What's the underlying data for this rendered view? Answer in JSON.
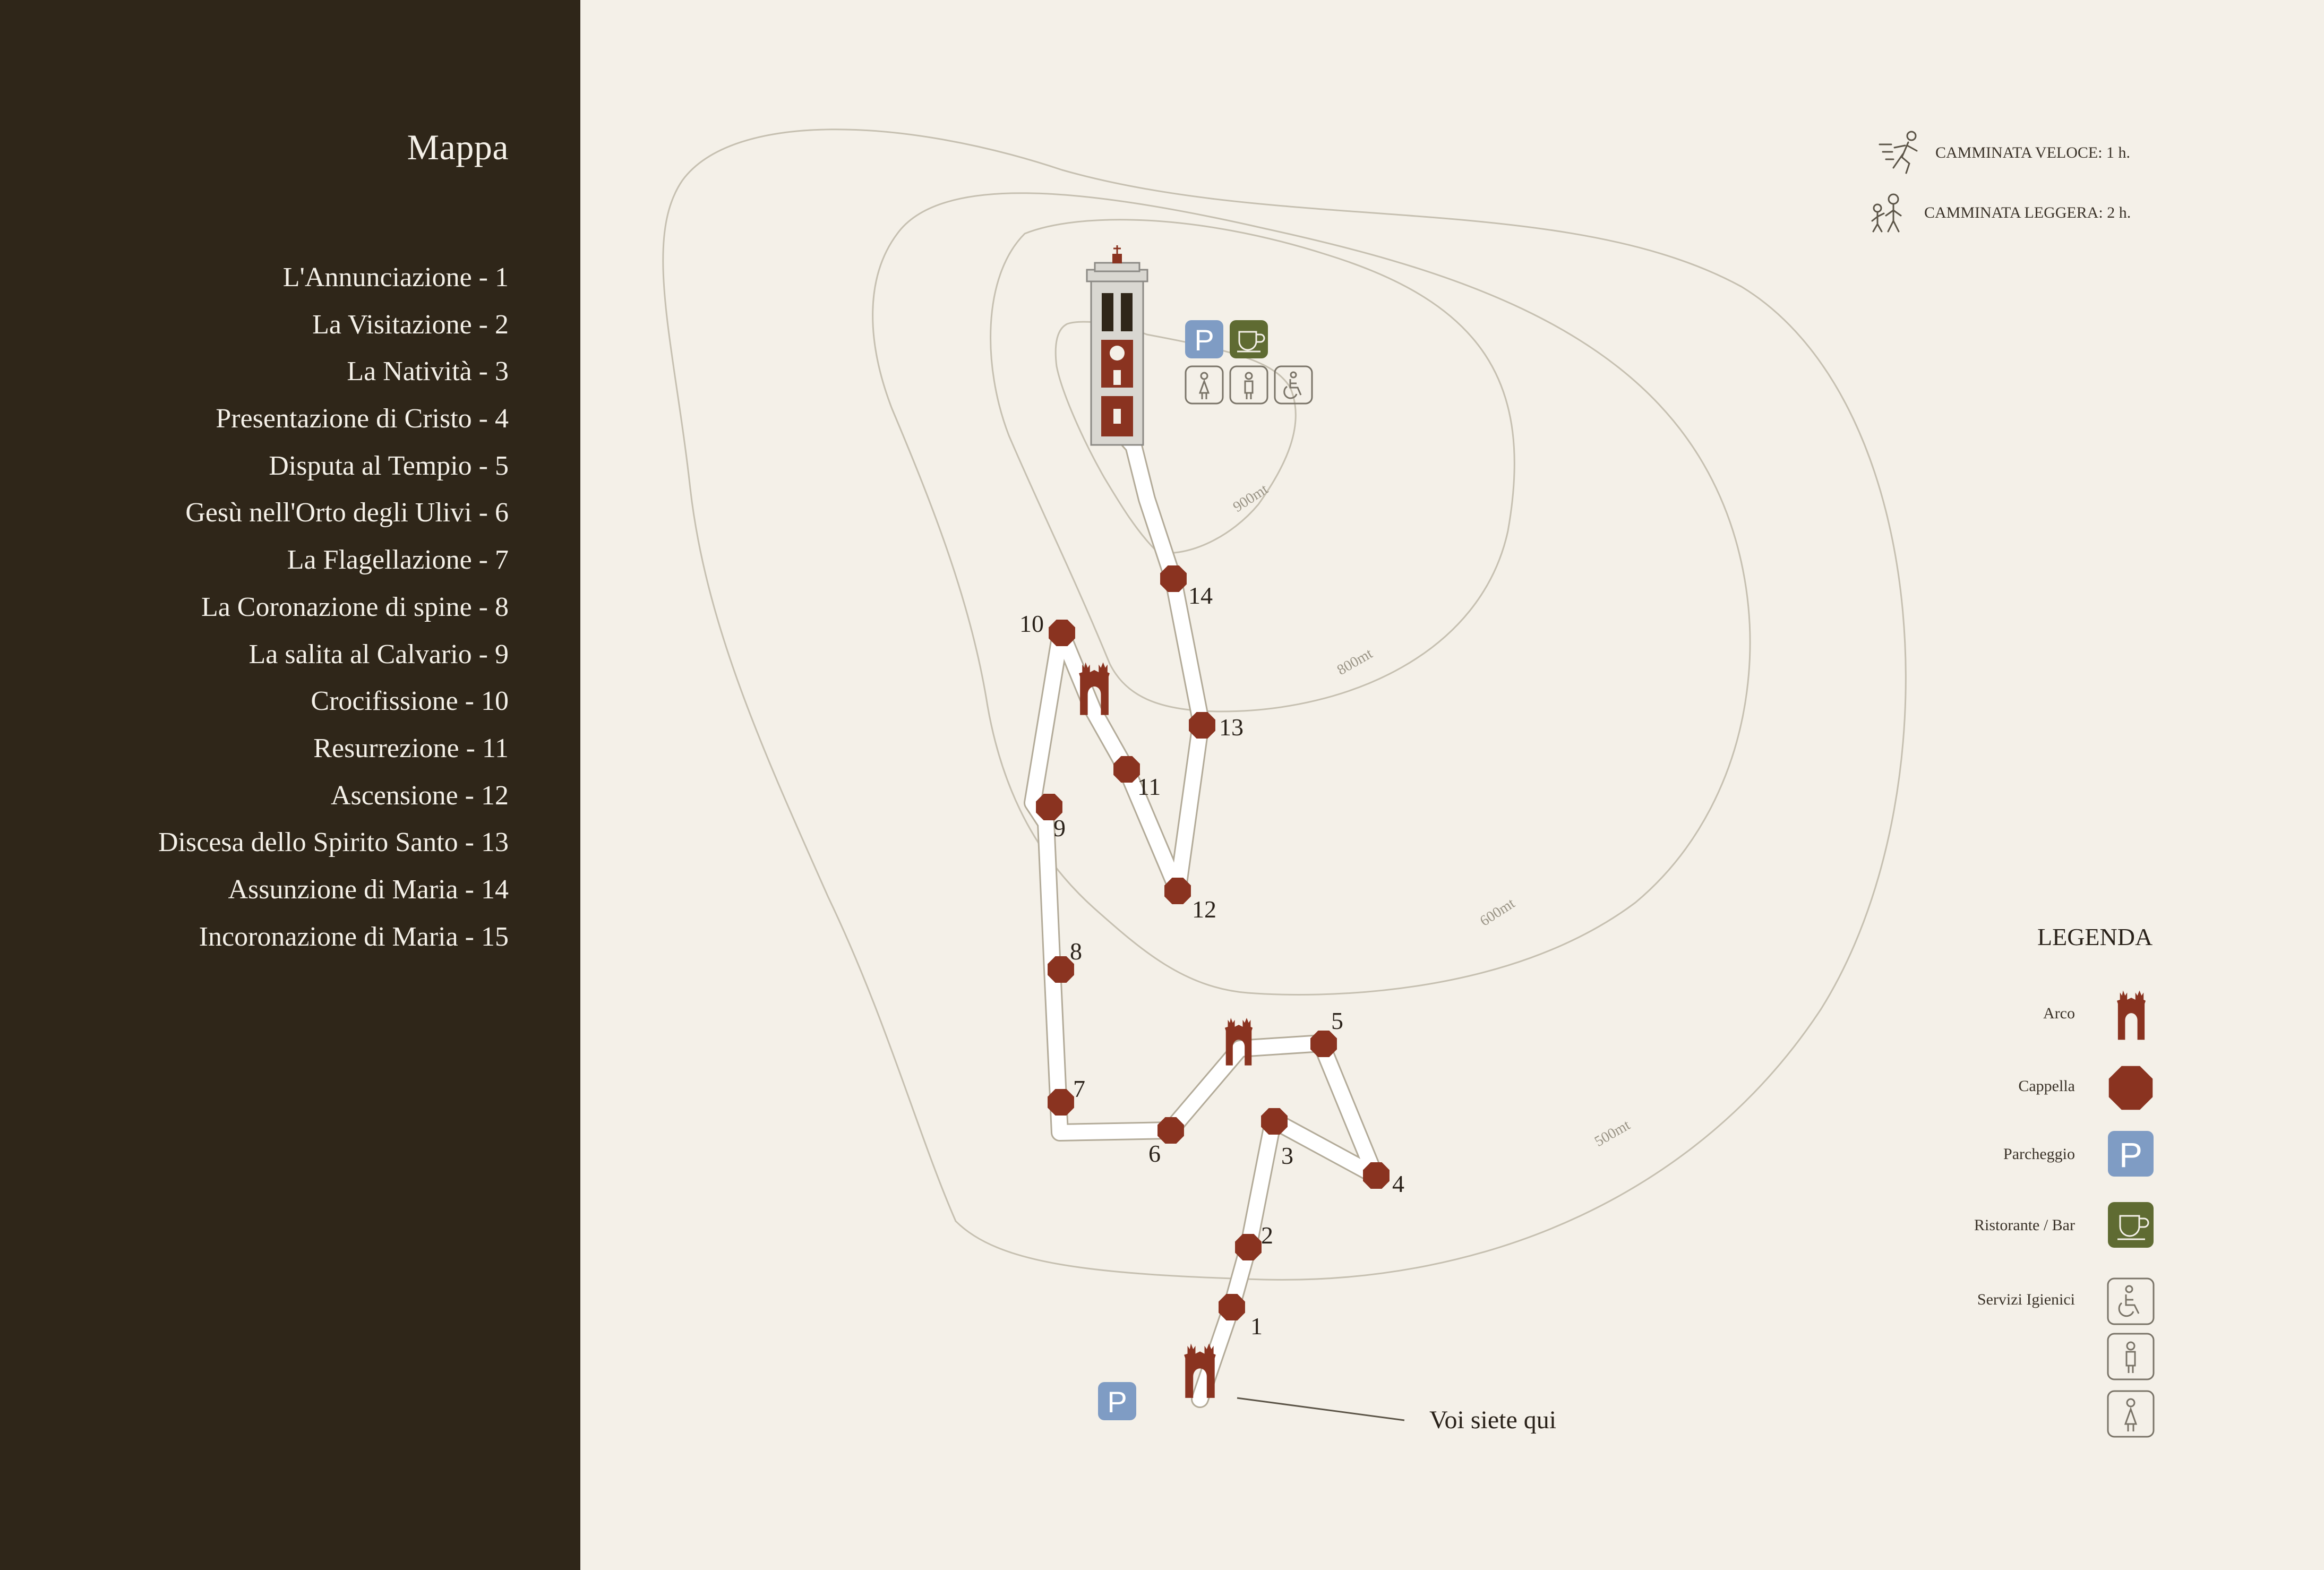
{
  "sidebar": {
    "title": "Mappa",
    "stations": [
      {
        "label": "L'Annunciazione - 1"
      },
      {
        "label": "La Visitazione - 2"
      },
      {
        "label": "La Natività - 3"
      },
      {
        "label": "Presentazione di Cristo - 4"
      },
      {
        "label": "Disputa al Tempio - 5"
      },
      {
        "label": "Gesù nell'Orto degli Ulivi - 6"
      },
      {
        "label": "La Flagellazione - 7"
      },
      {
        "label": "La Coronazione di spine - 8"
      },
      {
        "label": "La salita al Calvario - 9"
      },
      {
        "label": "Crocifissione - 10"
      },
      {
        "label": "Resurrezione - 11"
      },
      {
        "label": "Ascensione - 12"
      },
      {
        "label": "Discesa dello Spirito Santo - 13"
      },
      {
        "label": "Assunzione di Maria - 14"
      },
      {
        "label": "Incoronazione di Maria - 15"
      }
    ]
  },
  "walk_times": {
    "fast": {
      "label": "CAMMINATA VELOCE: 1 h.",
      "icon": "running-person-icon"
    },
    "slow": {
      "label": "CAMMINATA LEGGERA: 2 h.",
      "icon": "walking-people-icon"
    }
  },
  "legend": {
    "title": "LEGENDA",
    "items": [
      {
        "label": "Arco",
        "icon": "arch-icon"
      },
      {
        "label": "Cappella",
        "icon": "chapel-octagon-icon"
      },
      {
        "label": "Parcheggio",
        "icon": "parking-icon"
      },
      {
        "label": "Ristorante / Bar",
        "icon": "coffee-cup-icon"
      },
      {
        "label": "Servizi Igienici",
        "icon": "wheelchair-icon"
      }
    ]
  },
  "map": {
    "contours": [
      {
        "label": "900mt"
      },
      {
        "label": "800mt"
      },
      {
        "label": "600mt"
      },
      {
        "label": "500mt"
      }
    ],
    "chapels": [
      "1",
      "2",
      "3",
      "4",
      "5",
      "6",
      "7",
      "8",
      "9",
      "10",
      "11",
      "12",
      "13",
      "14"
    ],
    "you_are_here": "Voi siete qui",
    "parking_letter": "P"
  },
  "colors": {
    "sidebar_bg": "#2f2619",
    "page_bg": "#f4f0e8",
    "chapel": "#8a3320",
    "parking": "#7f9cc4",
    "bar": "#5f6b32",
    "contour": "#c6c0b1"
  }
}
